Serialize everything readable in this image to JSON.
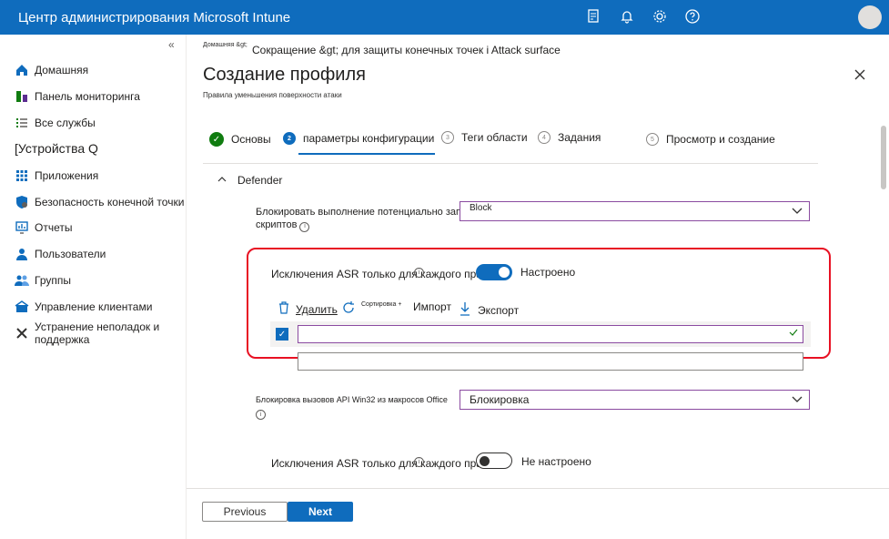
{
  "app": {
    "title": "Центр администрирования Microsoft Intune"
  },
  "sidebar": {
    "items": [
      {
        "label": "Домашняя",
        "icon": "home-icon"
      },
      {
        "label": "Панель мониторинга",
        "icon": "dashboard-icon"
      },
      {
        "label": "Все службы",
        "icon": "list-icon"
      },
      {
        "label": "[Устройства Q",
        "icon": ""
      },
      {
        "label": "Приложения",
        "icon": "apps-grid-icon"
      },
      {
        "label": "Безопасность конечной точки",
        "icon": "shield-icon"
      },
      {
        "label": "Отчеты",
        "icon": "reports-icon"
      },
      {
        "label": "Пользователи",
        "icon": "user-icon"
      },
      {
        "label": "Группы",
        "icon": "groups-icon"
      },
      {
        "label": "Управление клиентами",
        "icon": "tenant-icon"
      },
      {
        "label": "Устранение неполадок и поддержка",
        "icon": "wrench-icon"
      }
    ]
  },
  "breadcrumb": {
    "home": "Домашняя &gt;",
    "trail": "Сокращение &gt; для защиты конечных точек i Attack surface"
  },
  "page": {
    "title": "Создание профиля",
    "subtitle": "Правила уменьшения поверхности атаки"
  },
  "steps": [
    {
      "num": "✓",
      "label": "Основы"
    },
    {
      "num": "2",
      "label": "параметры конфигурации"
    },
    {
      "num": "3",
      "label": "Теги области"
    },
    {
      "num": "4",
      "label": "Задания"
    },
    {
      "num": "5",
      "label": "Просмотр и создание"
    }
  ],
  "section": {
    "title": "Defender"
  },
  "fields": {
    "f1_label_line1": "Блокировать выполнение потенциально запутывающихся",
    "f1_label_line2": "скриптов",
    "f1_value": "Block",
    "asr1_label": "Исключения ASR только для каждого правила",
    "asr1_state": "Настроено",
    "toolbar_delete": "Удалить",
    "toolbar_sort": "Сортировка +",
    "toolbar_import": "Импорт",
    "toolbar_export": "Экспорт",
    "f2_label": "Блокировка вызовов API Win32 из макросов Office",
    "f2_value": "Блокировка",
    "asr2_label": "Исключения ASR только для каждого правила",
    "asr2_state": "Не настроено"
  },
  "footer": {
    "previous": "Previous",
    "next": "Next"
  },
  "colors": {
    "accent": "#0f6cbd",
    "success": "#107c10",
    "highlight": "#e81123"
  }
}
